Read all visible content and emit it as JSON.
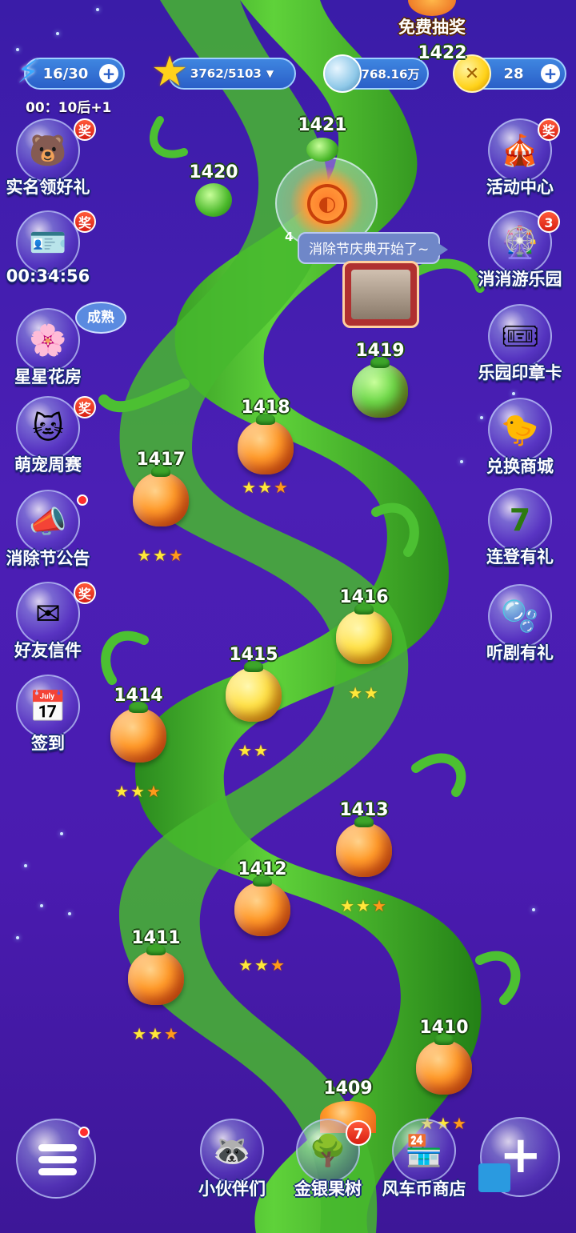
{
  "top_banner": {
    "label": "免费抽奖"
  },
  "resources": {
    "energy": {
      "value": "16/30",
      "timer": "00：10后+1"
    },
    "stars": {
      "value": "3762/5103"
    },
    "coins": {
      "value": "768.16万"
    },
    "tickets": {
      "value": "28"
    }
  },
  "left_menu": [
    {
      "label": "实名领好礼",
      "badge": "奖",
      "icon": "bear-coin-icon"
    },
    {
      "label": "00:34:56",
      "badge": "奖",
      "icon": "id-card-icon"
    },
    {
      "label": "星星花房",
      "badge": "成熟",
      "icon": "star-flower-icon"
    },
    {
      "label": "萌宠周赛",
      "badge": "奖",
      "icon": "cat-icon"
    },
    {
      "label": "消除节公告",
      "badge": "",
      "icon": "megaphone-icon"
    },
    {
      "label": "好友信件",
      "badge": "奖",
      "icon": "envelope-icon"
    },
    {
      "label": "签到",
      "badge": "",
      "icon": "calendar-icon"
    }
  ],
  "right_menu": [
    {
      "label": "活动中心",
      "badge": "奖",
      "icon": "tent-icon"
    },
    {
      "label": "消消游乐园",
      "badge": "3",
      "icon": "ferris-wheel-icon"
    },
    {
      "label": "乐园印章卡",
      "badge": "",
      "icon": "stamp-card-icon"
    },
    {
      "label": "兑换商城",
      "badge": "",
      "icon": "chick-shop-icon"
    },
    {
      "label": "连登有礼",
      "badge": "",
      "icon": "seven-icon"
    },
    {
      "label": "听剧有礼",
      "badge": "",
      "icon": "blue-character-icon"
    }
  ],
  "speech_bubble": "消除节庆典开始了~",
  "current_level_marker": "4",
  "levels": [
    {
      "num": "1422",
      "fruit": "none",
      "stars": 0
    },
    {
      "num": "1421",
      "fruit": "green",
      "stars": 0
    },
    {
      "num": "1420",
      "fruit": "green",
      "stars": 0
    },
    {
      "num": "1419",
      "fruit": "green",
      "stars": 0
    },
    {
      "num": "1418",
      "fruit": "orange",
      "stars": 3
    },
    {
      "num": "1417",
      "fruit": "orange",
      "stars": 3
    },
    {
      "num": "1416",
      "fruit": "gold",
      "stars": 2
    },
    {
      "num": "1415",
      "fruit": "gold",
      "stars": 2
    },
    {
      "num": "1414",
      "fruit": "orange",
      "stars": 3
    },
    {
      "num": "1413",
      "fruit": "orange",
      "stars": 3
    },
    {
      "num": "1412",
      "fruit": "orange",
      "stars": 3
    },
    {
      "num": "1411",
      "fruit": "orange",
      "stars": 3
    },
    {
      "num": "1410",
      "fruit": "orange",
      "stars": 3
    },
    {
      "num": "1409",
      "fruit": "orange",
      "stars": 0
    }
  ],
  "bottom_nav": [
    {
      "label": "小伙伴们",
      "badge": "",
      "icon": "raccoon-icon"
    },
    {
      "label": "金银果树",
      "badge": "7",
      "icon": "tree-icon"
    },
    {
      "label": "风车币商店",
      "badge": "",
      "icon": "shop-icon"
    }
  ],
  "colors": {
    "bg": "#4a1bb0",
    "stalk": "#3fb52a",
    "accent": "#ffe83a"
  }
}
